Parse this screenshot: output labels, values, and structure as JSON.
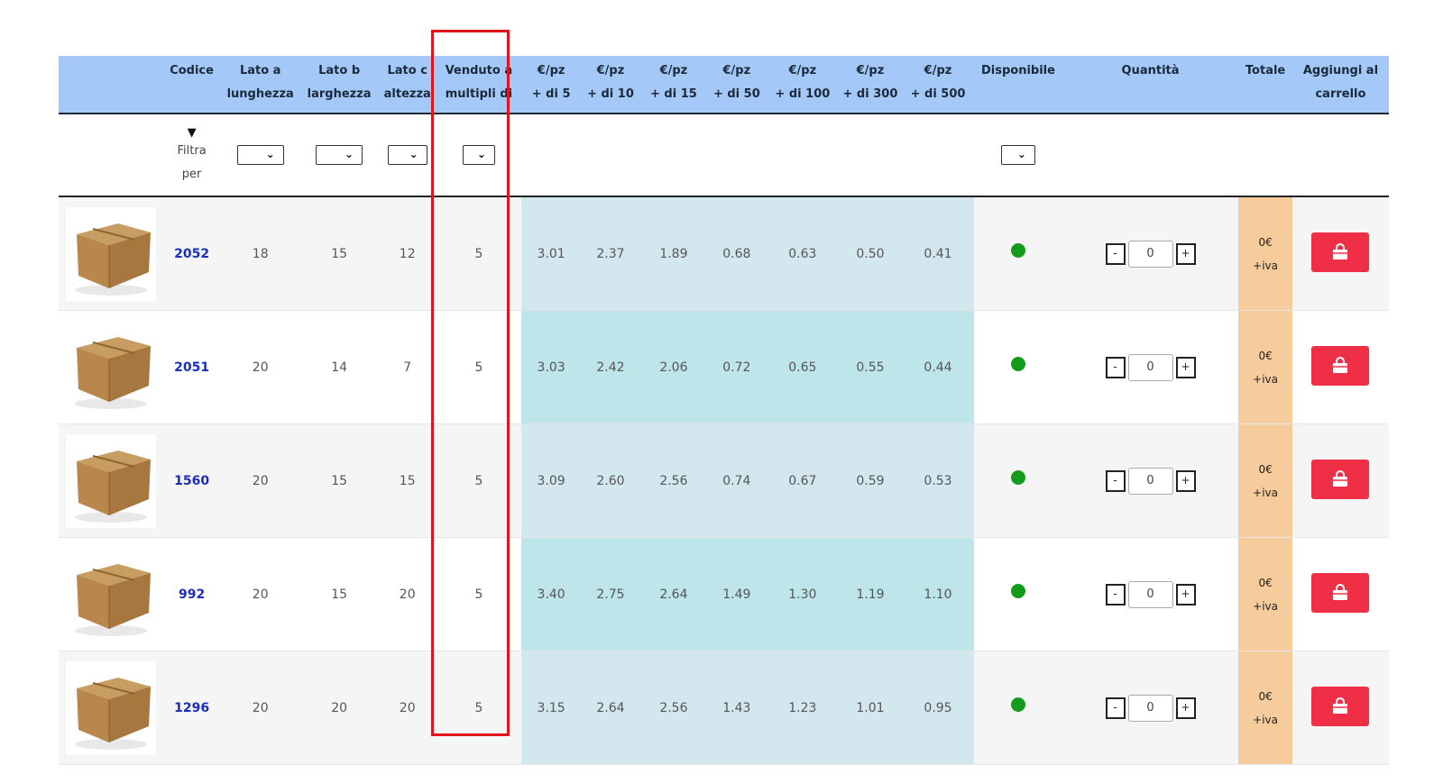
{
  "header": {
    "columns": [
      {
        "l1": "",
        "l2": ""
      },
      {
        "l1": "Codice",
        "l2": ""
      },
      {
        "l1": "Lato a",
        "l2": "lunghezza"
      },
      {
        "l1": "Lato b",
        "l2": "larghezza"
      },
      {
        "l1": "Lato c",
        "l2": "altezza"
      },
      {
        "l1": "Venduto a",
        "l2": "multipli di"
      },
      {
        "l1": "€/pz",
        "l2": "+ di 5"
      },
      {
        "l1": "€/pz",
        "l2": "+ di 10"
      },
      {
        "l1": "€/pz",
        "l2": "+ di 15"
      },
      {
        "l1": "€/pz",
        "l2": "+ di 50"
      },
      {
        "l1": "€/pz",
        "l2": "+ di 100"
      },
      {
        "l1": "€/pz",
        "l2": "+ di 300"
      },
      {
        "l1": "€/pz",
        "l2": "+ di 500"
      },
      {
        "l1": "Disponibile",
        "l2": ""
      },
      {
        "l1": "Quantità",
        "l2": ""
      },
      {
        "l1": "Totale",
        "l2": ""
      },
      {
        "l1": "Aggiungi al",
        "l2": "carrello"
      }
    ]
  },
  "filter": {
    "label_line1": "Filtra",
    "label_line2": "per",
    "icon": "filter-funnel-icon"
  },
  "rows": [
    {
      "code": "2052",
      "a": "18",
      "b": "15",
      "c": "12",
      "multipli": "5",
      "p5": "3.01",
      "p10": "2.37",
      "p15": "1.89",
      "p50": "0.68",
      "p100": "0.63",
      "p300": "0.50",
      "p500": "0.41",
      "qty": "0",
      "total": "0€",
      "iva": "+iva"
    },
    {
      "code": "2051",
      "a": "20",
      "b": "14",
      "c": "7",
      "multipli": "5",
      "p5": "3.03",
      "p10": "2.42",
      "p15": "2.06",
      "p50": "0.72",
      "p100": "0.65",
      "p300": "0.55",
      "p500": "0.44",
      "qty": "0",
      "total": "0€",
      "iva": "+iva"
    },
    {
      "code": "1560",
      "a": "20",
      "b": "15",
      "c": "15",
      "multipli": "5",
      "p5": "3.09",
      "p10": "2.60",
      "p15": "2.56",
      "p50": "0.74",
      "p100": "0.67",
      "p300": "0.59",
      "p500": "0.53",
      "qty": "0",
      "total": "0€",
      "iva": "+iva"
    },
    {
      "code": "992",
      "a": "20",
      "b": "15",
      "c": "20",
      "multipli": "5",
      "p5": "3.40",
      "p10": "2.75",
      "p15": "2.64",
      "p50": "1.49",
      "p100": "1.30",
      "p300": "1.19",
      "p500": "1.10",
      "qty": "0",
      "total": "0€",
      "iva": "+iva"
    },
    {
      "code": "1296",
      "a": "20",
      "b": "20",
      "c": "20",
      "multipli": "5",
      "p5": "3.15",
      "p10": "2.64",
      "p15": "2.56",
      "p50": "1.43",
      "p100": "1.23",
      "p300": "1.01",
      "p500": "0.95",
      "qty": "0",
      "total": "0€",
      "iva": "+iva"
    }
  ],
  "qty_controls": {
    "minus": "-",
    "plus": "+"
  },
  "colors": {
    "header_bg": "#a4c8f8",
    "price_bg_a": "#d3e8ee",
    "price_bg_b": "#bde5ea",
    "total_bg": "#f6cc9c",
    "cart_button": "#ef2f45",
    "available_dot": "#149b1b",
    "highlight_border": "#e0141a",
    "code_link": "#1a2ebf"
  }
}
